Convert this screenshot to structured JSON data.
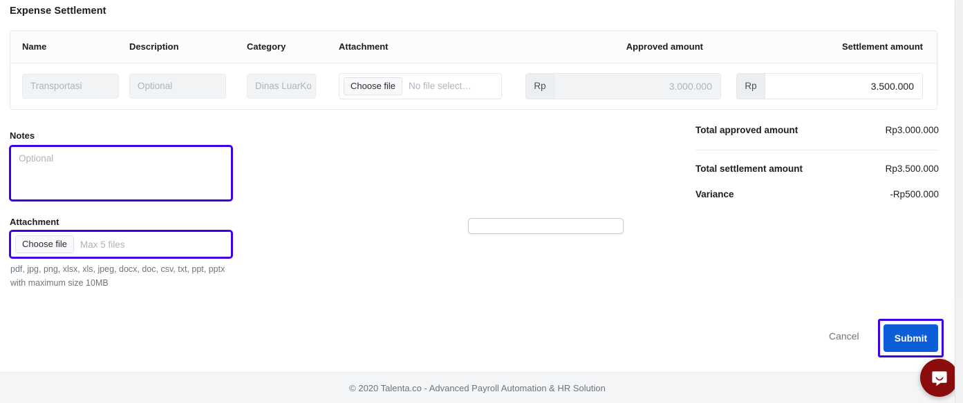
{
  "page": {
    "title": "Expense Settlement"
  },
  "table": {
    "headers": {
      "name": "Name",
      "description": "Description",
      "category": "Category",
      "attachment": "Attachment",
      "approved_amount": "Approved amount",
      "settlement_amount": "Settlement amount"
    },
    "rows": [
      {
        "name_value": "Transportasi",
        "description_placeholder": "Optional",
        "category_value": "Dinas LuarKo",
        "attachment_button": "Choose file",
        "attachment_status": "No file select…",
        "approved_currency": "Rp",
        "approved_value": "3.000.000",
        "settlement_currency": "Rp",
        "settlement_value": "3.500.000"
      }
    ]
  },
  "notes": {
    "label": "Notes",
    "placeholder": "Optional",
    "value": ""
  },
  "attachment": {
    "label": "Attachment",
    "button_label": "Choose file",
    "status_text": "Max 5 files",
    "hint_line_1": "pdf, jpg, png, xlsx, xls, jpeg, docx, doc, csv, txt, ppt, pptx",
    "hint_line_2": "with maximum size 10MB"
  },
  "summary": {
    "total_approved_label": "Total approved amount",
    "total_approved_value": "Rp3.000.000",
    "total_settlement_label": "Total settlement amount",
    "total_settlement_value": "Rp3.500.000",
    "variance_label": "Variance",
    "variance_value": "-Rp500.000"
  },
  "actions": {
    "cancel_label": "Cancel",
    "submit_label": "Submit"
  },
  "footer": {
    "copyright": "© 2020 Talenta.co - Advanced Payroll Automation & HR Solution"
  },
  "colors": {
    "focus_outline": "#3d00e8",
    "submit_blue": "#0b5ed7",
    "chat_red": "#8b0c0c",
    "footer_bg": "#f4f5f7"
  }
}
